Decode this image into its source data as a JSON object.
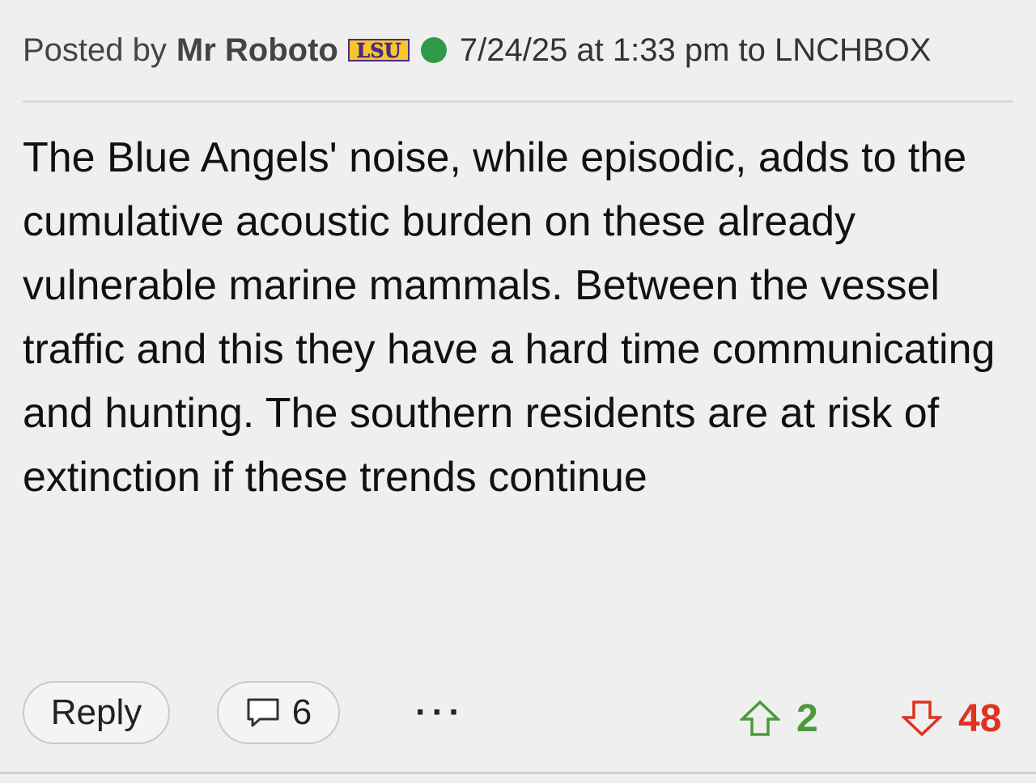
{
  "header": {
    "posted_by_label": "Posted by",
    "author": "Mr Roboto",
    "team_logo_text": "LSU",
    "timestamp": "7/24/25 at 1:33 pm to LNCHBOX",
    "online_status_color": "#2e9a48"
  },
  "post": {
    "body": "The Blue Angels' noise, while episodic, adds to the cumulative acoustic burden on these already vulnerable marine mammals. Between the vessel traffic and this they have a hard time communicating and hunting. The southern residents are at risk of extinction if these trends continue"
  },
  "actions": {
    "reply_label": "Reply",
    "comment_count": "6",
    "comment_icon": "speech-bubble-icon",
    "more_label": "···"
  },
  "votes": {
    "up_count": "2",
    "up_icon": "up-arrow-outline-icon",
    "up_color": "#4a9a3a",
    "down_count": "48",
    "down_icon": "down-arrow-outline-icon",
    "down_color": "#e0321f"
  }
}
